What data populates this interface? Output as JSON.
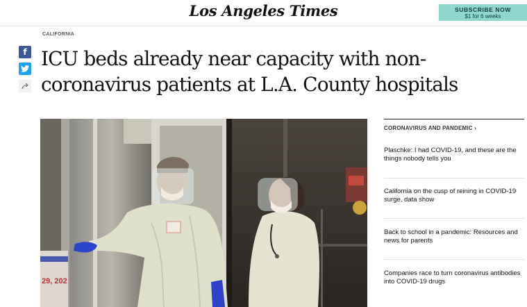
{
  "header": {
    "logo": "Los Angeles Times",
    "subscribe_line1": "SUBSCRIBE NOW",
    "subscribe_line2": "$1 for 6 weeks"
  },
  "article": {
    "section": "CALIFORNIA",
    "headline": "ICU beds already near capacity with non-coronavirus patients at L.A. County hospitals",
    "photo_sign_text": "29, 202"
  },
  "share": {
    "facebook_glyph": "f"
  },
  "rail": {
    "heading": "CORONAVIRUS AND PANDEMIC",
    "heading_chevron": "›",
    "items": [
      "Plaschke: I had COVID-19, and these are the things nobody tells you",
      "California on the cusp of reining in COVID-19 surge, data show",
      "Back to school in a pandemic: Resources and news for parents",
      "Companies race to turn coronavirus antibodies into COVID-19 drugs"
    ]
  },
  "colors": {
    "subscribe_bg": "#8fd6cc",
    "facebook": "#3b5998",
    "twitter": "#1da1f2",
    "ppe_gown": "#dfe0c9",
    "glove": "#2b44c9"
  }
}
